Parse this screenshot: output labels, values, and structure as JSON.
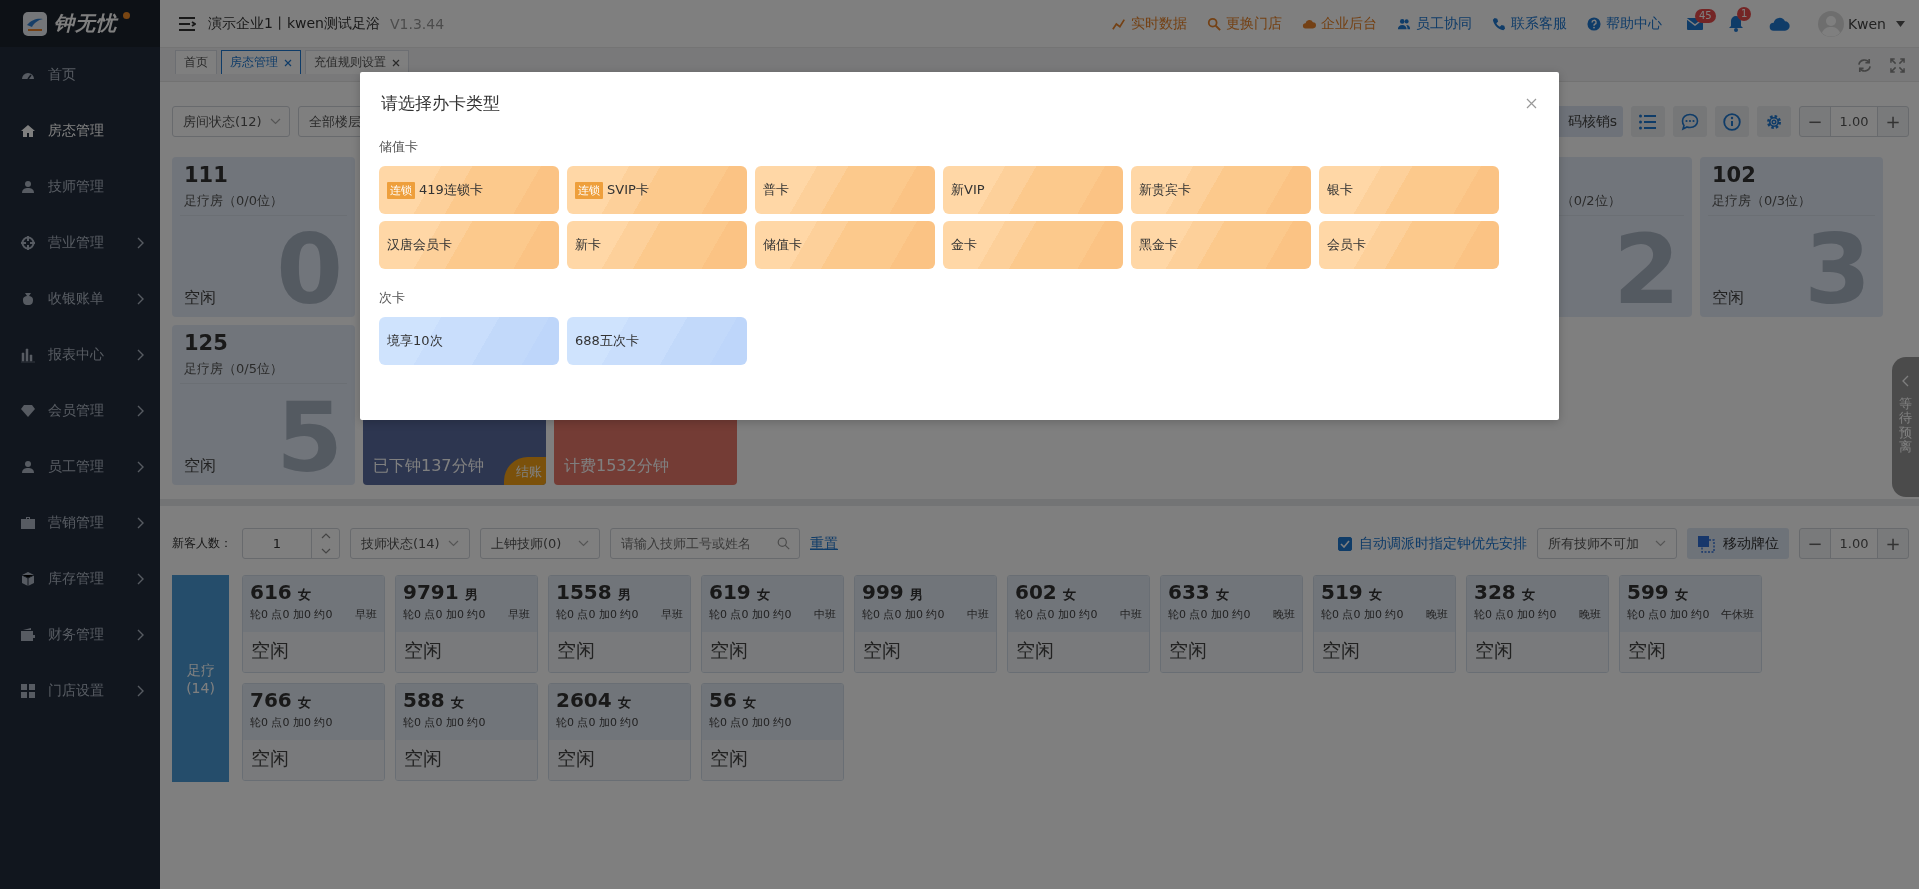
{
  "sidebar": {
    "logo": "钟无忧",
    "items": [
      {
        "label": "首页",
        "selected": false,
        "submenu": false
      },
      {
        "label": "房态管理",
        "selected": true,
        "submenu": false
      },
      {
        "label": "技师管理",
        "selected": false,
        "submenu": false
      },
      {
        "label": "营业管理",
        "selected": false,
        "submenu": true
      },
      {
        "label": "收银账单",
        "selected": false,
        "submenu": true
      },
      {
        "label": "报表中心",
        "selected": false,
        "submenu": true
      },
      {
        "label": "会员管理",
        "selected": false,
        "submenu": true
      },
      {
        "label": "员工管理",
        "selected": false,
        "submenu": true
      },
      {
        "label": "营销管理",
        "selected": false,
        "submenu": true
      },
      {
        "label": "库存管理",
        "selected": false,
        "submenu": true
      },
      {
        "label": "财务管理",
        "selected": false,
        "submenu": true
      },
      {
        "label": "门店设置",
        "selected": false,
        "submenu": true
      }
    ]
  },
  "header": {
    "title": "演示企业1丨kwen测试足浴",
    "version": "V1.3.44",
    "links": [
      {
        "label": "实时数据",
        "accent": true
      },
      {
        "label": "更换门店",
        "accent": true
      },
      {
        "label": "企业后台",
        "accent": true
      },
      {
        "label": "员工协同",
        "accent": false
      },
      {
        "label": "联系客服",
        "accent": false
      },
      {
        "label": "帮助中心",
        "accent": false
      }
    ],
    "mail_badge": "45",
    "bell_badge": "1",
    "user": "Kwen"
  },
  "tabs": [
    {
      "label": "首页",
      "selected": false,
      "closable": false
    },
    {
      "label": "房态管理",
      "selected": true,
      "closable": true
    },
    {
      "label": "充值规则设置",
      "selected": false,
      "closable": true
    }
  ],
  "room_toolbar": {
    "filters": [
      "房间状态(12)",
      "全部楼层"
    ],
    "verify_button": "码核销s",
    "zoom_minus": "−",
    "zoom_value": "1.00",
    "zoom_plus": "+"
  },
  "room_rows": [
    [
      {
        "kind": "idle",
        "number": "111",
        "subtitle": "足疗房（0/0位）",
        "digit": "0",
        "status": "空闲"
      },
      {
        "kind": "partial",
        "subtitle": "（0/2位）",
        "digit": "2"
      },
      {
        "kind": "idle",
        "number": "102",
        "subtitle": "足疗房（0/3位）",
        "digit": "3",
        "status": "空闲"
      }
    ],
    [
      {
        "kind": "idle",
        "number": "125",
        "subtitle": "足疗房（0/5位）",
        "digit": "5",
        "status": "空闲"
      },
      {
        "kind": "clocked_out",
        "status": "已下钟137分钟",
        "badge": "结账"
      },
      {
        "kind": "billing",
        "status": "计费1532分钟"
      }
    ]
  ],
  "side_tab": "等待预离",
  "tech_toolbar": {
    "guests_label": "新客人数：",
    "guests_value": "1",
    "filters": [
      "技师状态(14)",
      "上钟技师(0)"
    ],
    "search": {
      "placeholder": "请输入技师工号或姓名"
    },
    "reset": "重置",
    "auto_dispatch": {
      "label": "自动调派时指定钟优先安排",
      "checked": true
    },
    "overtime_select": "所有技师不可加",
    "move_button": "移动牌位",
    "zoom_minus": "−",
    "zoom_value": "1.00",
    "zoom_plus": "+"
  },
  "tech_group": {
    "name": "足疗",
    "count": "(14)"
  },
  "technicians": [
    {
      "number": "616",
      "gender": "女",
      "stats": "轮0 点0 加0 约0",
      "shift": "早班",
      "status": "空闲"
    },
    {
      "number": "9791",
      "gender": "男",
      "stats": "轮0 点0 加0 约0",
      "shift": "早班",
      "status": "空闲"
    },
    {
      "number": "1558",
      "gender": "男",
      "stats": "轮0 点0 加0 约0",
      "shift": "早班",
      "status": "空闲"
    },
    {
      "number": "619",
      "gender": "女",
      "stats": "轮0 点0 加0 约0",
      "shift": "中班",
      "status": "空闲"
    },
    {
      "number": "999",
      "gender": "男",
      "stats": "轮0 点0 加0 约0",
      "shift": "中班",
      "status": "空闲"
    },
    {
      "number": "602",
      "gender": "女",
      "stats": "轮0 点0 加0 约0",
      "shift": "中班",
      "status": "空闲"
    },
    {
      "number": "633",
      "gender": "女",
      "stats": "轮0 点0 加0 约0",
      "shift": "晚班",
      "status": "空闲"
    },
    {
      "number": "519",
      "gender": "女",
      "stats": "轮0 点0 加0 约0",
      "shift": "晚班",
      "status": "空闲"
    },
    {
      "number": "328",
      "gender": "女",
      "stats": "轮0 点0 加0 约0",
      "shift": "晚班",
      "status": "空闲"
    },
    {
      "number": "599",
      "gender": "女",
      "stats": "轮0 点0 加0 约0",
      "shift": "午休班",
      "status": "空闲"
    },
    {
      "number": "766",
      "gender": "女",
      "stats": "轮0 点0 加0 约0",
      "status": "空闲"
    },
    {
      "number": "588",
      "gender": "女",
      "stats": "轮0 点0 加0 约0",
      "status": "空闲"
    },
    {
      "number": "2604",
      "gender": "女",
      "stats": "轮0 点0 加0 约0",
      "status": "空闲"
    },
    {
      "number": "56",
      "gender": "女",
      "stats": "轮0 点0 加0 约0",
      "status": "空闲"
    }
  ],
  "dialog": {
    "title": "请选择办卡类型",
    "sections": [
      {
        "title": "储值卡",
        "kind": "stored",
        "cards": [
          {
            "label": "419连锁卡",
            "tag": "连锁"
          },
          {
            "label": "SVIP卡",
            "tag": "连锁"
          },
          {
            "label": "普卡"
          },
          {
            "label": "新VIP"
          },
          {
            "label": "新贵宾卡"
          },
          {
            "label": "银卡"
          },
          {
            "label": "汉唐会员卡"
          },
          {
            "label": "新卡"
          },
          {
            "label": "储值卡"
          },
          {
            "label": "金卡"
          },
          {
            "label": "黑金卡"
          },
          {
            "label": "会员卡"
          }
        ]
      },
      {
        "title": "次卡",
        "kind": "count",
        "cards": [
          {
            "label": "境享10次"
          },
          {
            "label": "688五次卡"
          }
        ]
      }
    ]
  }
}
